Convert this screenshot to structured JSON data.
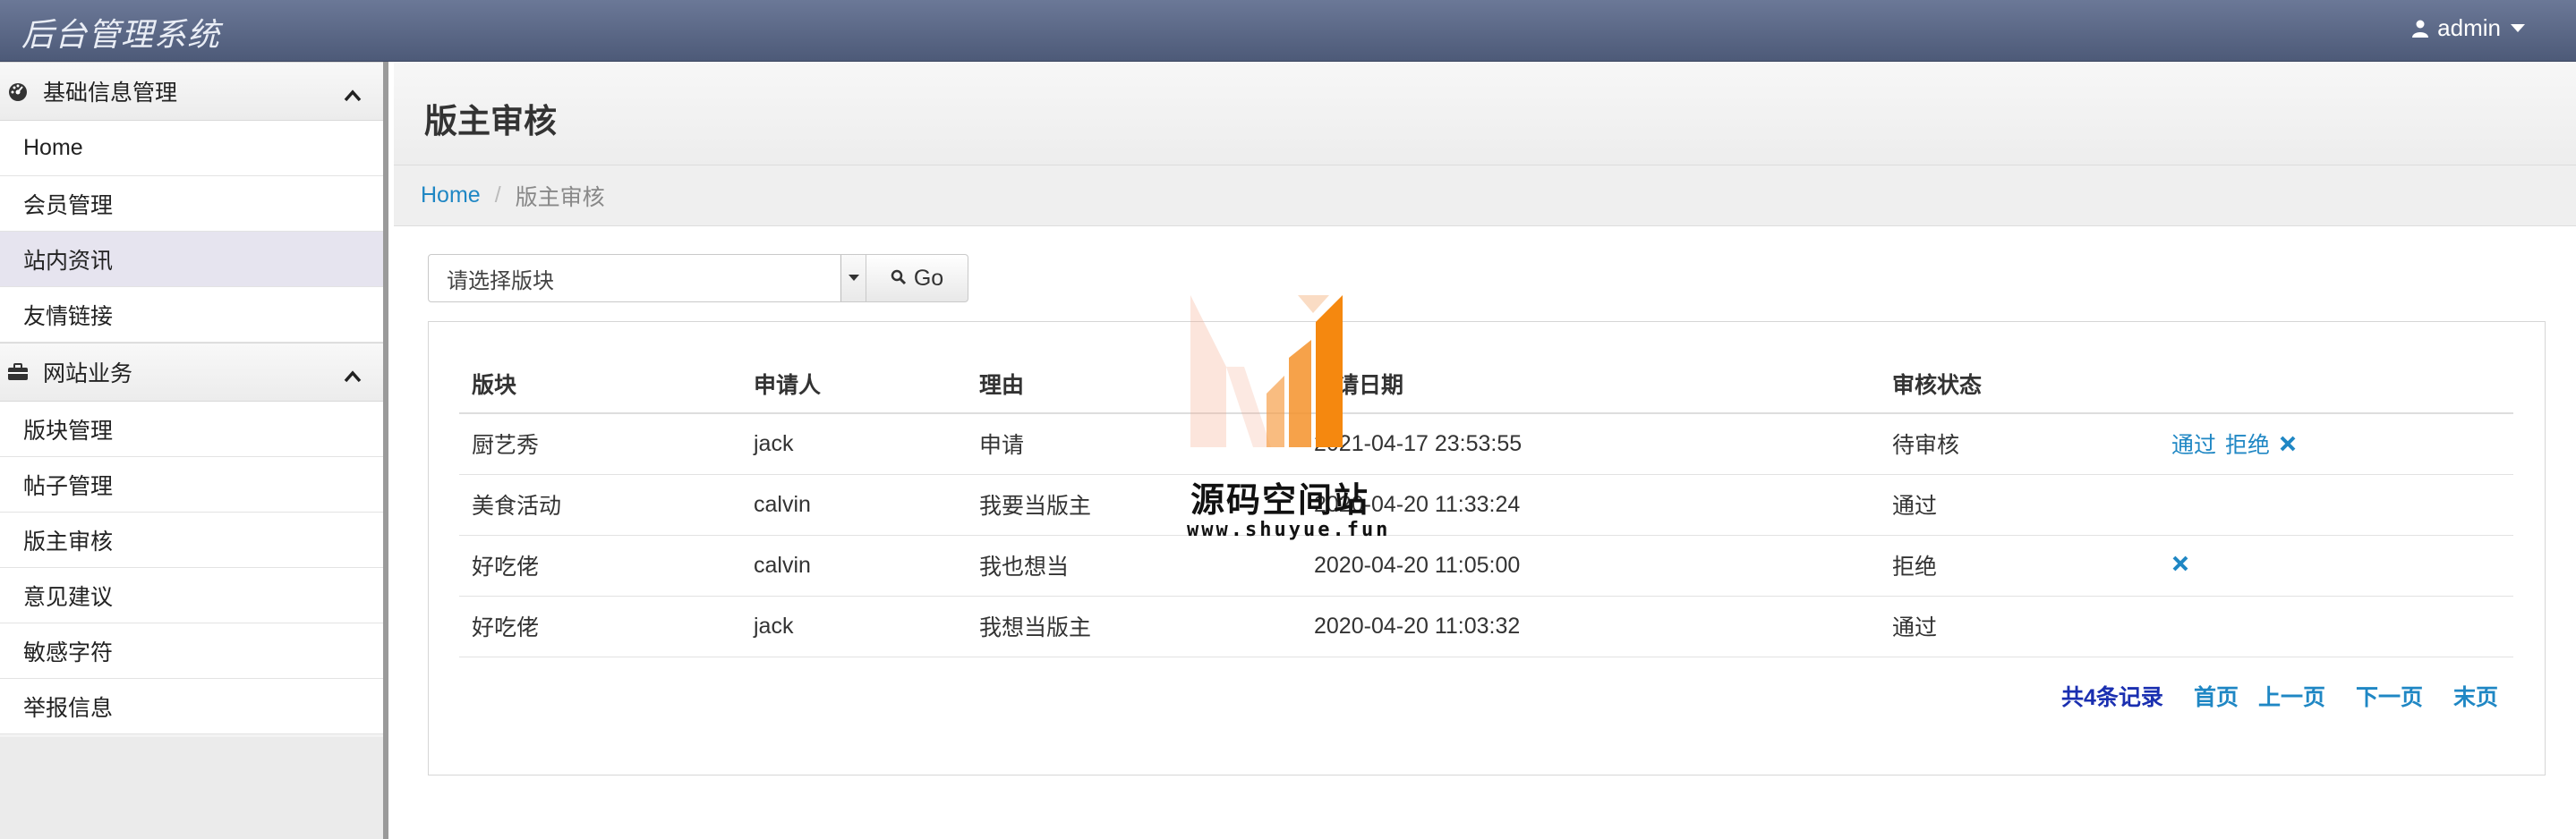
{
  "app": {
    "brand": "后台管理系统",
    "user": "admin"
  },
  "sidebar": {
    "groups": [
      {
        "label": "基础信息管理",
        "items": [
          {
            "label": "Home"
          },
          {
            "label": "会员管理"
          },
          {
            "label": "站内资讯"
          },
          {
            "label": "友情链接"
          }
        ]
      },
      {
        "label": "网站业务",
        "items": [
          {
            "label": "版块管理"
          },
          {
            "label": "帖子管理"
          },
          {
            "label": "版主审核"
          },
          {
            "label": "意见建议"
          },
          {
            "label": "敏感字符"
          },
          {
            "label": "举报信息"
          }
        ]
      }
    ],
    "active_item": "站内资讯"
  },
  "page": {
    "title": "版主审核"
  },
  "breadcrumb": {
    "home": "Home",
    "current": "版主审核"
  },
  "filter": {
    "select_value": "请选择版块",
    "go_label": "Go"
  },
  "table": {
    "headers": [
      "版块",
      "申请人",
      "理由",
      "申请日期",
      "审核状态",
      ""
    ],
    "rows": [
      {
        "board": "厨艺秀",
        "applicant": "jack",
        "reason": "申请",
        "date": "2021-04-17 23:53:55",
        "status": "待审核",
        "actions": [
          "通过",
          "拒绝"
        ]
      },
      {
        "board": "美食活动",
        "applicant": "calvin",
        "reason": "我要当版主",
        "date": "2020-04-20 11:33:24",
        "status": "通过",
        "actions": []
      },
      {
        "board": "好吃佬",
        "applicant": "calvin",
        "reason": "我也想当",
        "date": "2020-04-20 11:05:00",
        "status": "拒绝",
        "actions": []
      },
      {
        "board": "好吃佬",
        "applicant": "jack",
        "reason": "我想当版主",
        "date": "2020-04-20 11:03:32",
        "status": "通过",
        "actions": []
      }
    ]
  },
  "pager": {
    "total": "共4条记录",
    "first": "首页",
    "prev": "上一页",
    "next": "下一页",
    "last": "末页"
  },
  "watermark": {
    "text": "源码空间站",
    "url": "www.shuyue.fun"
  },
  "colors": {
    "link": "#1f87c4",
    "topbar": "#5a6785",
    "total": "#1a2fb0",
    "watermark_orange": "#f5922a"
  }
}
